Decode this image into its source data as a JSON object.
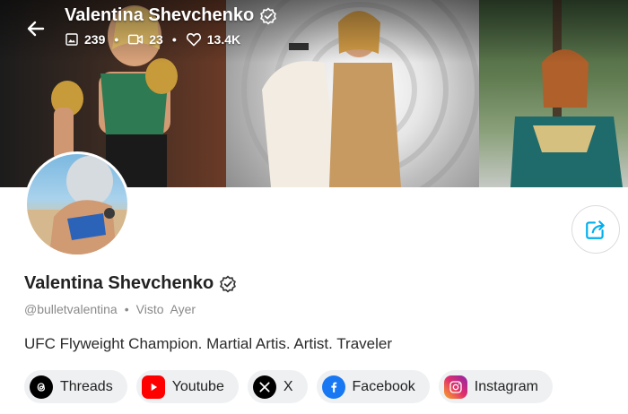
{
  "header": {
    "title": "Valentina Shevchenko",
    "stats": {
      "photos": "239",
      "videos": "23",
      "likes": "13.4K"
    }
  },
  "profile": {
    "name": "Valentina Shevchenko",
    "handle": "@bulletvalentina",
    "separator": "•",
    "last_seen": "Visto  Ayer",
    "bio": "UFC Flyweight Champion. Martial Artis. Artist. Traveler"
  },
  "links": [
    {
      "label": "Threads",
      "icon": "threads-icon",
      "color": "#000000"
    },
    {
      "label": "Youtube",
      "icon": "youtube-icon",
      "color": "#ff0000"
    },
    {
      "label": "X",
      "icon": "x-icon",
      "color": "#000000"
    },
    {
      "label": "Facebook",
      "icon": "facebook-icon",
      "color": "#1877f2"
    },
    {
      "label": "Instagram",
      "icon": "instagram-icon",
      "color": "#e1306c"
    }
  ],
  "colors": {
    "accent": "#00aff0",
    "verified": "#ffffff"
  }
}
